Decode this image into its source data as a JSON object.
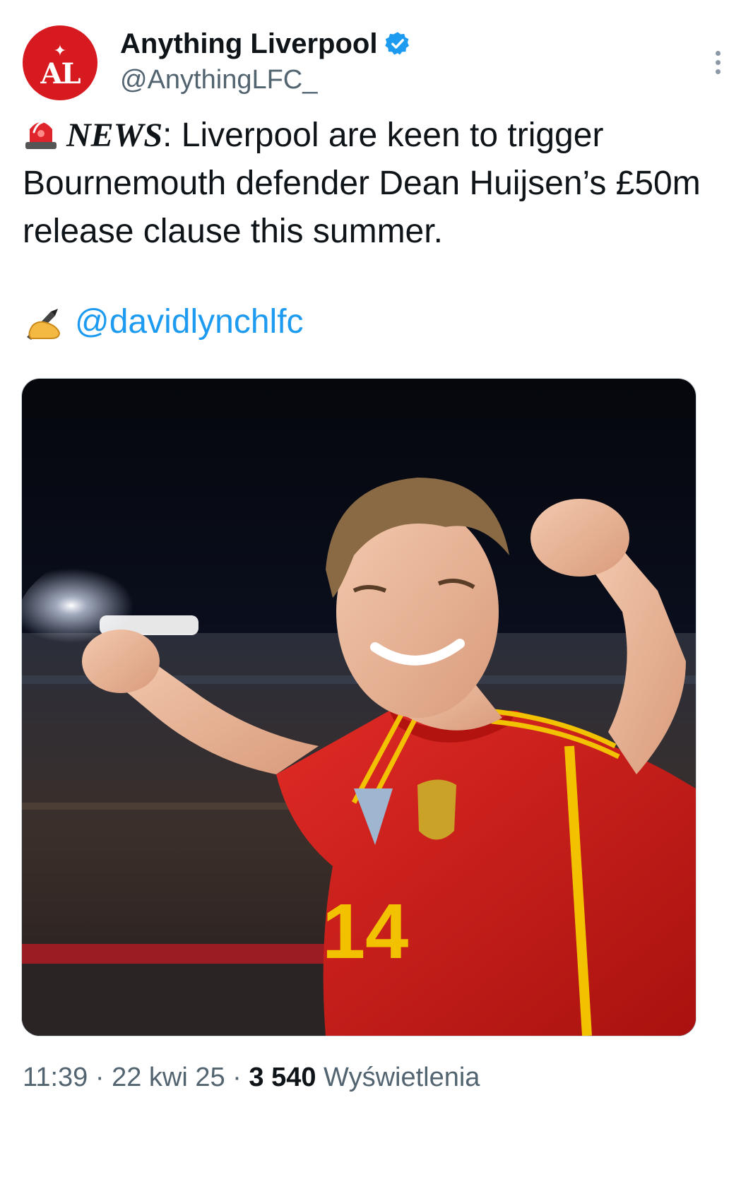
{
  "author": {
    "display_name": "Anything Liverpool",
    "handle": "@AnythingLFC_",
    "avatar_text": "AL",
    "verified": true,
    "avatar_color": "#d71920"
  },
  "tweet": {
    "news_label": "NEWS",
    "news_colon": ":",
    "body": " Liverpool are keen to trigger Bournemouth defender Dean Huijsen’s £50m release clause this summer.",
    "mention": "@davidlynchlfc",
    "siren_icon": "police-car-light-icon",
    "writing_icon": "writing-hand-icon"
  },
  "media": {
    "jersey_number": "14"
  },
  "meta": {
    "time": "11:39",
    "sep1": " · ",
    "date": "22 kwi 25",
    "sep2": " · ",
    "views_count": "3 540",
    "views_label": " Wyświetlenia"
  },
  "colors": {
    "link": "#1d9bf0",
    "secondary_text": "#536471",
    "verified": "#1d9bf0"
  }
}
